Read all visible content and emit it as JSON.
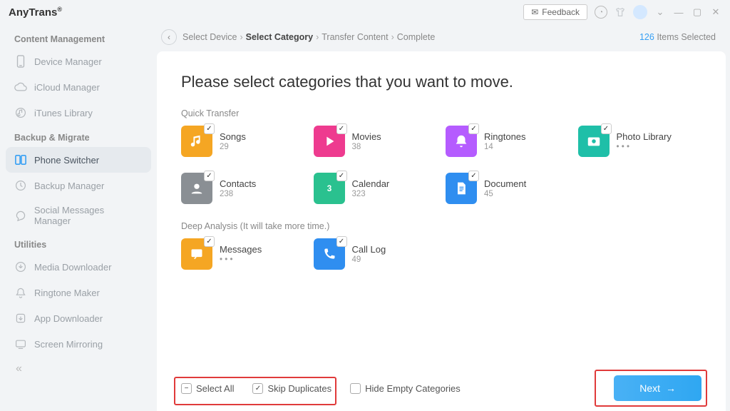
{
  "app": {
    "title": "AnyTrans",
    "trademark": "®"
  },
  "topbar": {
    "feedback_label": "Feedback"
  },
  "sidebar": {
    "sections": [
      {
        "title": "Content Management",
        "items": [
          {
            "id": "device-manager",
            "label": "Device Manager"
          },
          {
            "id": "icloud-manager",
            "label": "iCloud Manager"
          },
          {
            "id": "itunes-library",
            "label": "iTunes Library"
          }
        ]
      },
      {
        "title": "Backup & Migrate",
        "items": [
          {
            "id": "phone-switcher",
            "label": "Phone Switcher",
            "active": true
          },
          {
            "id": "backup-manager",
            "label": "Backup Manager"
          },
          {
            "id": "social-messages",
            "label": "Social Messages Manager"
          }
        ]
      },
      {
        "title": "Utilities",
        "items": [
          {
            "id": "media-downloader",
            "label": "Media Downloader"
          },
          {
            "id": "ringtone-maker",
            "label": "Ringtone Maker"
          },
          {
            "id": "app-downloader",
            "label": "App Downloader"
          },
          {
            "id": "screen-mirroring",
            "label": "Screen Mirroring"
          }
        ]
      }
    ]
  },
  "breadcrumb": {
    "steps": [
      "Select Device",
      "Select Category",
      "Transfer Content",
      "Complete"
    ],
    "active_index": 1,
    "items_selected_count": "126",
    "items_selected_label": "Items Selected"
  },
  "page": {
    "heading": "Please select categories that you want to move.",
    "quick_transfer_label": "Quick Transfer",
    "deep_analysis_label": "Deep Analysis (It will take more time.)",
    "quick_categories": [
      {
        "id": "songs",
        "name": "Songs",
        "count": "29",
        "color": "#f5a623",
        "checked": true
      },
      {
        "id": "movies",
        "name": "Movies",
        "count": "38",
        "color": "#ee3b8f",
        "checked": true
      },
      {
        "id": "ringtones",
        "name": "Ringtones",
        "count": "14",
        "color": "#b55cff",
        "checked": true
      },
      {
        "id": "photo-library",
        "name": "Photo Library",
        "count": "• • •",
        "color": "#1fbfa8",
        "checked": true
      },
      {
        "id": "contacts",
        "name": "Contacts",
        "count": "238",
        "color": "#8a8f94",
        "checked": true
      },
      {
        "id": "calendar",
        "name": "Calendar",
        "count": "323",
        "color": "#2ac18f",
        "checked": true
      },
      {
        "id": "document",
        "name": "Document",
        "count": "45",
        "color": "#2f8ef0",
        "checked": true
      }
    ],
    "deep_categories": [
      {
        "id": "messages",
        "name": "Messages",
        "count": "• • •",
        "color": "#f5a623",
        "checked": true
      },
      {
        "id": "call-log",
        "name": "Call Log",
        "count": "49",
        "color": "#2f8ef0",
        "checked": true
      }
    ]
  },
  "footer": {
    "select_all_label": "Select All",
    "select_all_state": "indeterminate",
    "skip_duplicates_label": "Skip Duplicates",
    "skip_duplicates_checked": true,
    "hide_empty_label": "Hide Empty Categories",
    "hide_empty_checked": false,
    "next_label": "Next"
  }
}
